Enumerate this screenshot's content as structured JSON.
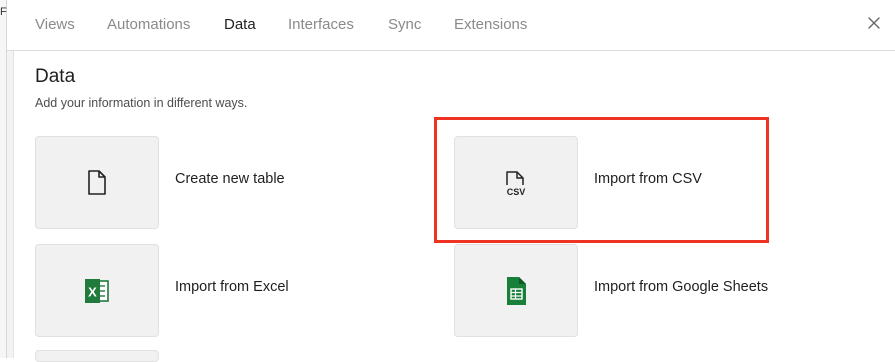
{
  "backdrop": {
    "mark": "F"
  },
  "tabs": [
    {
      "label": "Views",
      "active": false
    },
    {
      "label": "Automations",
      "active": false
    },
    {
      "label": "Data",
      "active": true
    },
    {
      "label": "Interfaces",
      "active": false
    },
    {
      "label": "Sync",
      "active": false
    },
    {
      "label": "Extensions",
      "active": false
    }
  ],
  "close_icon": "close-icon",
  "section": {
    "title": "Data",
    "subtitle": "Add your information in different ways."
  },
  "options": [
    {
      "label": "Create new table",
      "icon": "document-icon"
    },
    {
      "label": "Import from CSV",
      "icon": "csv-file-icon",
      "icon_text": "CSV"
    },
    {
      "label": "Import from Excel",
      "icon": "excel-icon",
      "icon_text": "X"
    },
    {
      "label": "Import from Google Sheets",
      "icon": "google-sheets-icon"
    }
  ],
  "colors": {
    "highlight": "#ee3320",
    "excel_green": "#1f7a3c",
    "sheets_green": "#188038"
  }
}
